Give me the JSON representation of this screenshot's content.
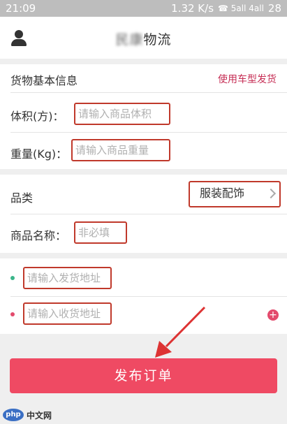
{
  "statusbar": {
    "time": "21:09",
    "speed": "1.32 K/s",
    "signal": "☎ 5all 4all",
    "battery": "28"
  },
  "header": {
    "title": "物流",
    "title_blur": "民康"
  },
  "section1": {
    "title": "货物基本信息",
    "link": "使用车型发货"
  },
  "volume": {
    "label": "体积(方)：",
    "placeholder": "请输入商品体积"
  },
  "weight": {
    "label": "重量(Kg)：",
    "placeholder": "请输入商品重量"
  },
  "category": {
    "label": "品类",
    "value": "服装配饰"
  },
  "product_name": {
    "label": "商品名称：",
    "placeholder": "非必填"
  },
  "ship_from": {
    "placeholder": "请输入发货地址",
    "dot_color": "#3bb58a"
  },
  "ship_to": {
    "placeholder": "请输入收货地址",
    "dot_color": "#e34a6c"
  },
  "submit": {
    "label": "发布订单"
  },
  "watermark": {
    "logo": "php",
    "site": "中文网"
  },
  "colors": {
    "accent": "#ef4a63",
    "highlight_border": "#c0392b",
    "link": "#c62d54"
  }
}
